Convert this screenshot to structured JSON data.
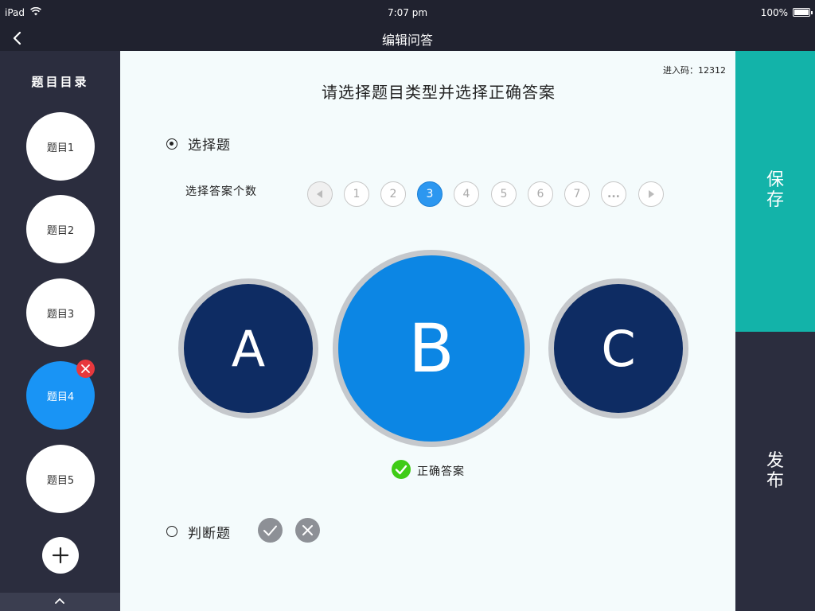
{
  "status_bar": {
    "device": "iPad",
    "time": "7:07 pm",
    "battery": "100%"
  },
  "nav": {
    "title": "编辑问答",
    "back_icon": "chevron-left-icon"
  },
  "sidebar": {
    "heading": "题目目录",
    "items": [
      {
        "label": "题目1",
        "active": false
      },
      {
        "label": "题目2",
        "active": false
      },
      {
        "label": "题目3",
        "active": false
      },
      {
        "label": "题目4",
        "active": true
      },
      {
        "label": "题目5",
        "active": false
      }
    ],
    "add_icon": "plus-icon",
    "delete_icon": "close-icon",
    "collapse_icon": "chevron-up-icon"
  },
  "main": {
    "access_code": "进入码：12312",
    "title": "请选择题目类型并选择正确答案",
    "choice": {
      "label": "选择题",
      "selected": true,
      "count_label": "选择答案个数",
      "pager": [
        "1",
        "2",
        "3",
        "4",
        "5",
        "6",
        "7",
        "..."
      ],
      "selected_count": "3",
      "options": [
        "A",
        "B",
        "C"
      ],
      "correct_option": "B",
      "correct_label": "正确答案"
    },
    "truefalse": {
      "label": "判断题",
      "selected": false
    }
  },
  "actions": {
    "save_chars": [
      "保",
      "存"
    ],
    "publish_chars": [
      "发",
      "布"
    ]
  },
  "colors": {
    "dark_bg": "#20222f",
    "sidebar_bg": "#2b2d3e",
    "accent_blue": "#1994f5",
    "save_teal": "#13b3a9",
    "option_navy": "#0e2c63",
    "option_selected": "#0c86e4",
    "correct_green": "#3fcc16",
    "delete_red": "#e8383d"
  }
}
